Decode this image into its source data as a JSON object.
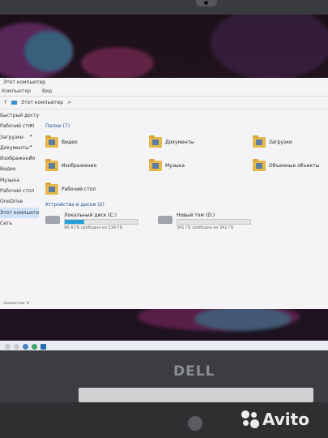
{
  "window": {
    "title": "Этот компьютер"
  },
  "ribbon": [
    "Компьютер",
    "Вид"
  ],
  "address": {
    "path": "Этот компьютер",
    "chevron": ">"
  },
  "nav": {
    "items": [
      "Быстрый доступ",
      "Рабочий стол",
      "Загрузки",
      "Документы",
      "Изображения",
      "Видео",
      "Музыка",
      "Рабочий стол",
      "OneDrive",
      "Этот компьютер",
      "Сеть"
    ],
    "pin_icon": "pin-icon"
  },
  "folders": {
    "header": "Папки (7)",
    "items": [
      "Видео",
      "Документы",
      "Загрузки",
      "Изображения",
      "Музыка",
      "Объемные объекты",
      "Рабочий стол"
    ]
  },
  "drives": {
    "header": "Устройства и диски (2)",
    "items": [
      {
        "name": "Локальный диск (C:)",
        "free": "98,4 ГБ свободно из 134 ГБ",
        "used_fraction": 0.27
      },
      {
        "name": "Новый том (D:)",
        "free": "341 ГБ свободно из 341 ГБ",
        "used_fraction": 0.0
      }
    ]
  },
  "status": {
    "text": "Элементов: 9"
  },
  "laptop": {
    "brand": "DELL"
  },
  "watermark": {
    "brand": "Avito"
  },
  "colors": {
    "accent": "#26a0da",
    "folder": "#e7b84a",
    "bezel": "#3a3b3e"
  }
}
